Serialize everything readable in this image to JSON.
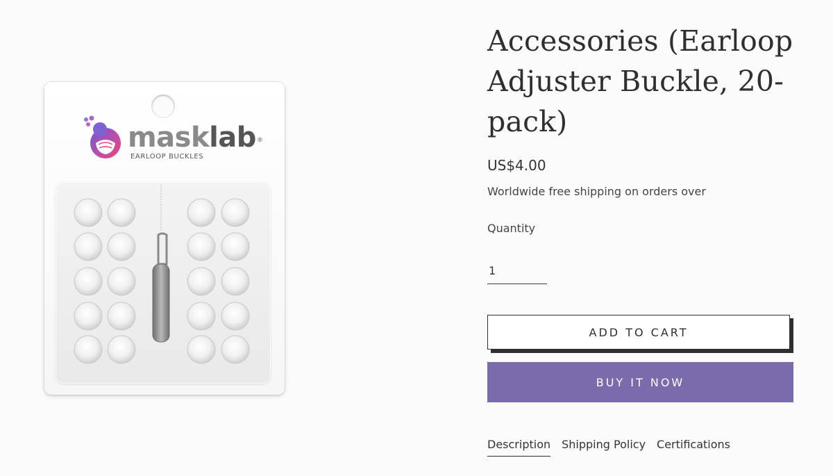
{
  "product": {
    "title": "Accessories (Earloop Adjuster Buckle, 20-pack)",
    "price": "US$4.00",
    "shipping_note": "Worldwide free shipping on orders over"
  },
  "image": {
    "brand_mask": "mask",
    "brand_lab": "lab",
    "brand_reg": "®",
    "brand_subtitle": "EARLOOP BUCKLES"
  },
  "quantity": {
    "label": "Quantity",
    "value": "1"
  },
  "buttons": {
    "add_to_cart": "ADD TO CART",
    "buy_now": "BUY IT NOW"
  },
  "tabs": [
    {
      "label": "Description",
      "active": true
    },
    {
      "label": "Shipping Policy",
      "active": false
    },
    {
      "label": "Certifications",
      "active": false
    }
  ],
  "colors": {
    "background": "#fbfbfb",
    "accent": "#7b6bac",
    "text": "#2f2f2f",
    "logo_pink": "#e8457f",
    "logo_purple": "#6a5bd0"
  }
}
